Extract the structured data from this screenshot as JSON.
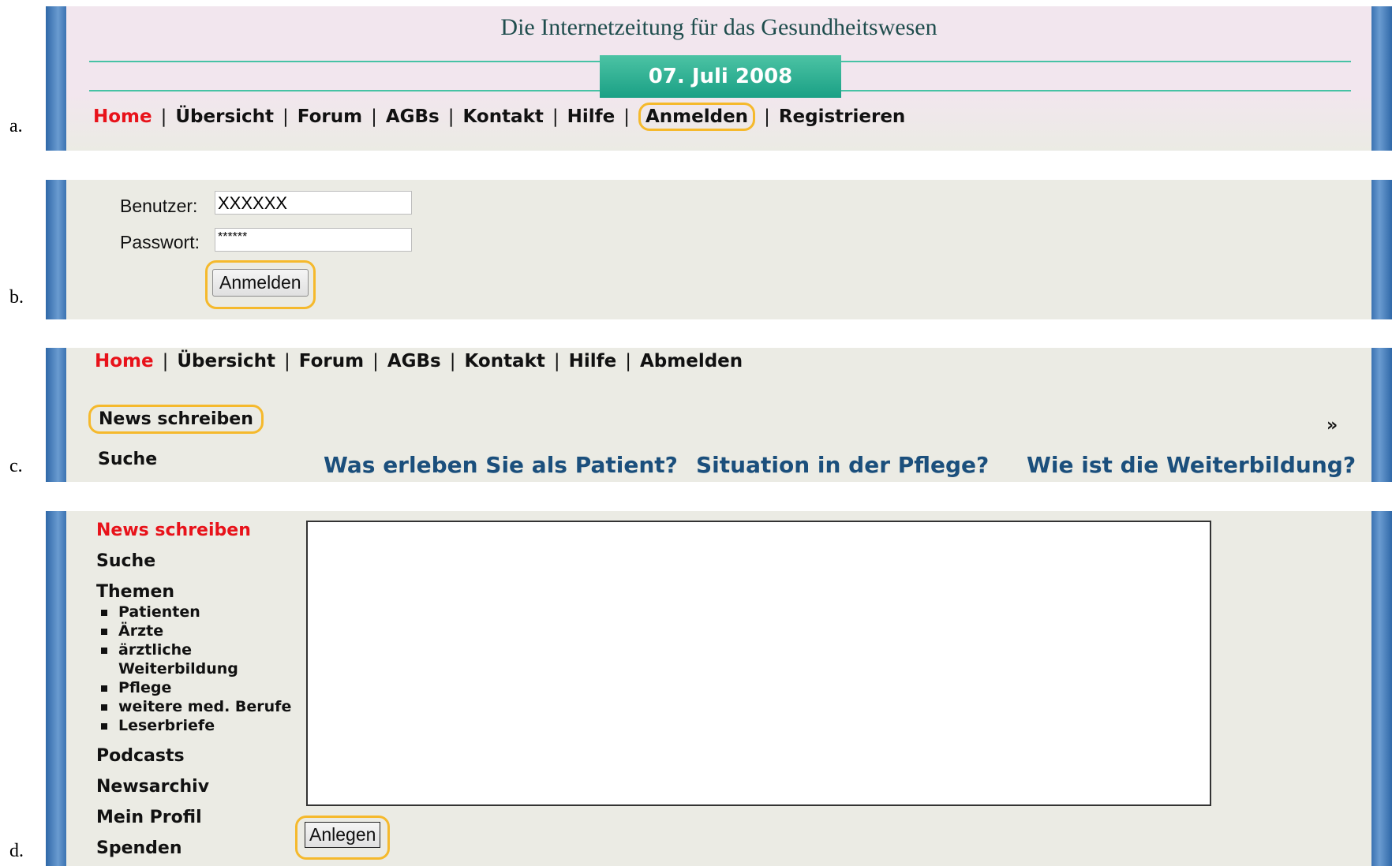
{
  "labels": [
    "a.",
    "b.",
    "c.",
    "d."
  ],
  "panel_a": {
    "site_title": "Die Internetzeitung für das Gesundheitswesen",
    "date": "07. Juli 2008",
    "nav": [
      {
        "label": "Home",
        "active": true
      },
      {
        "label": "Übersicht"
      },
      {
        "label": "Forum"
      },
      {
        "label": "AGBs"
      },
      {
        "label": "Kontakt"
      },
      {
        "label": "Hilfe"
      },
      {
        "label": "Anmelden",
        "highlighted": true
      },
      {
        "label": "Registrieren"
      }
    ],
    "separator": "|"
  },
  "panel_b": {
    "user_label": "Benutzer:",
    "user_value": "XXXXXX",
    "password_label": "Passwort:",
    "password_value": "******",
    "submit_label": "Anmelden"
  },
  "panel_c": {
    "nav": [
      "Home",
      "Übersicht",
      "Forum",
      "AGBs",
      "Kontakt",
      "Hilfe",
      "Abmelden"
    ],
    "news_write": "News schreiben",
    "search": "Suche",
    "more": "»",
    "questions": [
      "Was erleben Sie als Patient?",
      "Situation in der Pflege?",
      "Wie ist die Weiterbildung?"
    ]
  },
  "panel_d": {
    "menu": {
      "news_write": "News schreiben",
      "search": "Suche",
      "topics": "Themen",
      "topic_items": [
        "Patienten",
        "Ärzte",
        "ärztliche Weiterbildung",
        "Pflege",
        "weitere med. Berufe",
        "Leserbriefe"
      ],
      "podcasts": "Podcasts",
      "archive": "Newsarchiv",
      "profile": "Mein Profil",
      "donate": "Spenden"
    },
    "create_label": "Anlegen"
  },
  "colors": {
    "accent_red": "#e8121a",
    "teal": "#1aa085",
    "highlight": "#f5b92c",
    "link_blue": "#1b4f7c"
  }
}
